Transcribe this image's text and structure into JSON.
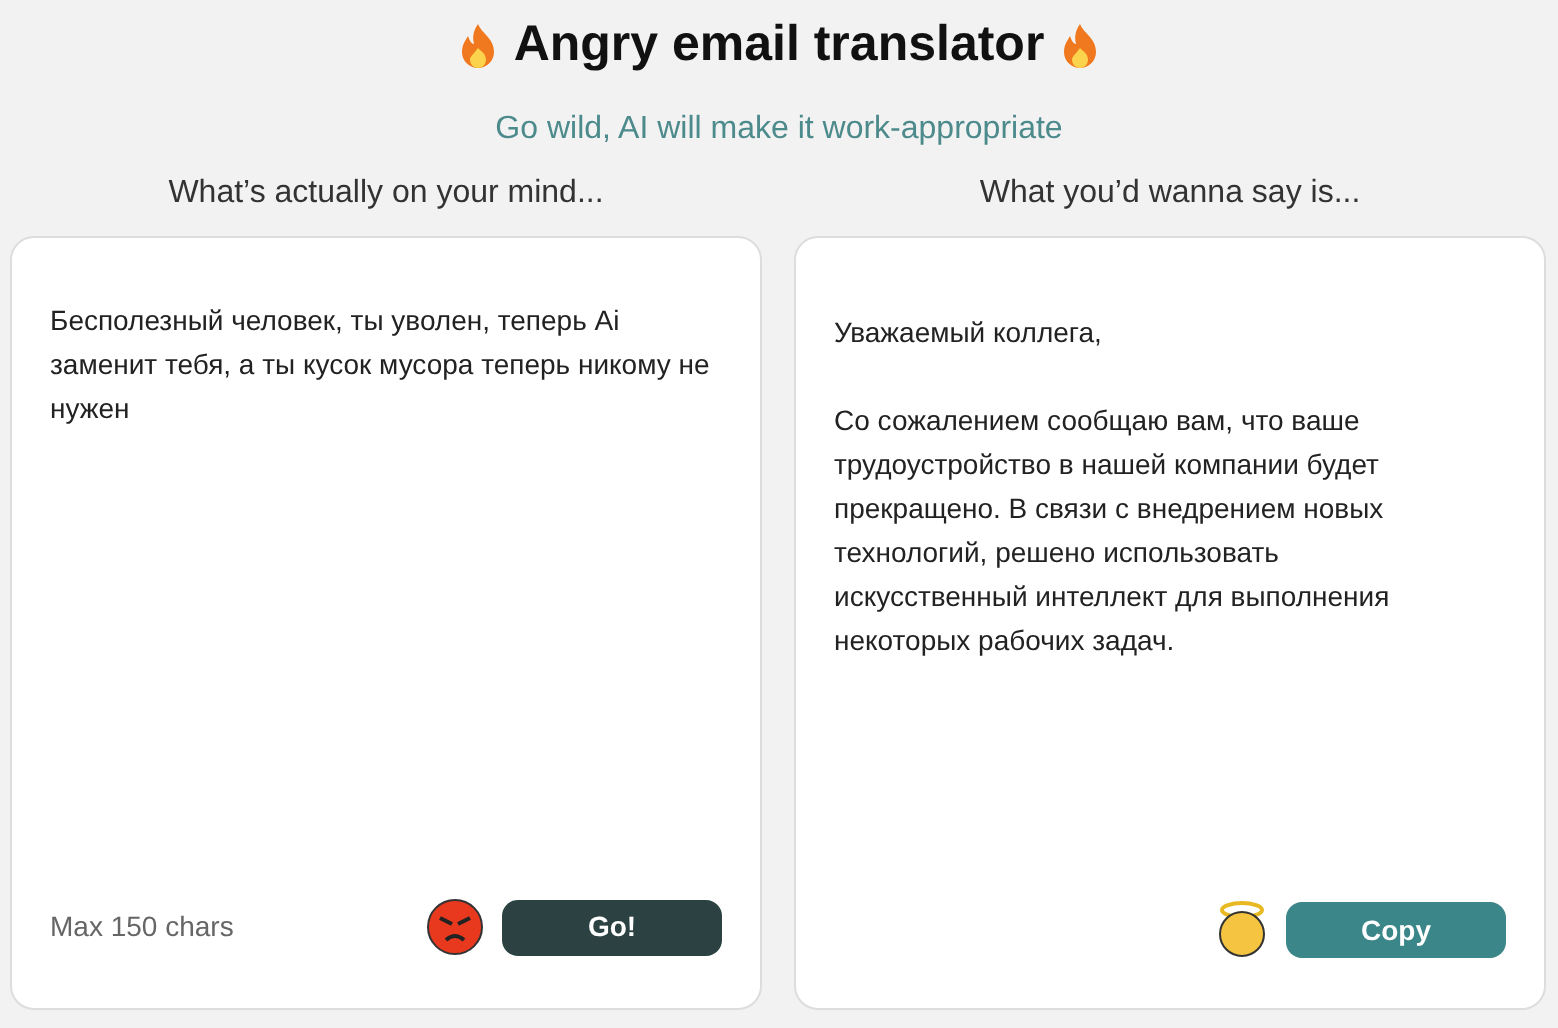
{
  "title": "Angry email translator",
  "subtitle": "Go wild, AI will make it work-appropriate",
  "input_panel": {
    "heading": "What’s actually on your mind...",
    "value": "Бесполезный человек, ты уволен, теперь Ai заменит тебя, а ты кусок мусора теперь никому не нужен",
    "hint": "Max 150 chars",
    "button": "Go!"
  },
  "output_panel": {
    "heading": "What you’d wanna say is...",
    "paragraphs": [
      "Уважаемый коллега,",
      "Со сожалением сообщаю вам, что ваше трудоустройство в нашей компании будет прекращено. В связи с внедрением новых технологий, решено использовать искусственный интеллект для выполнения некоторых рабочих задач."
    ],
    "button": "Copy"
  }
}
